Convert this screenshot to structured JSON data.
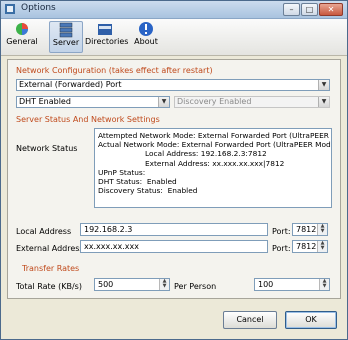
{
  "window": {
    "title": "Options"
  },
  "toolbar": {
    "items": [
      {
        "label": "General",
        "icon": "general-icon"
      },
      {
        "label": "Server",
        "icon": "server-icon"
      },
      {
        "label": "Directories",
        "icon": "directories-icon"
      },
      {
        "label": "About",
        "icon": "about-icon"
      }
    ]
  },
  "network_config": {
    "heading": "Network Configuration (takes effect after restart)",
    "mode_value": "External (Forwarded) Port",
    "dht_value": "DHT Enabled",
    "discovery_value": "Discovery Enabled"
  },
  "server_status": {
    "heading": "Server Status And Network Settings",
    "network_status_label": "Network Status",
    "status_text": "Attempted Network Mode: External Forwarded Port (UltraPEER Mode)\nActual Network Mode: External Forwarded Port (UltraPEER Mode)\n                    Local Address: 192.168.2.3:7812\n                    External Address: xx.xxx.xx.xxx|7812\nUPnP Status:\nDHT Status:  Enabled\nDiscovery Status:  Enabled",
    "local_address_label": "Local Address",
    "local_address_value": "192.168.2.3",
    "external_address_label": "External Address",
    "external_address_value": "xx.xxx.xx.xxx",
    "port_label": "Port:",
    "local_port": "7812",
    "external_port": "7812"
  },
  "transfer_rates": {
    "heading": "Transfer Rates",
    "total_rate_label": "Total Rate (KB/s)",
    "total_rate_value": "500",
    "per_person_label": "Per Person",
    "per_person_value": "100"
  },
  "buttons": {
    "cancel": "Cancel",
    "ok": "OK"
  },
  "colors": {
    "section_heading": "#c04a1c",
    "field_border": "#7f9db9"
  }
}
